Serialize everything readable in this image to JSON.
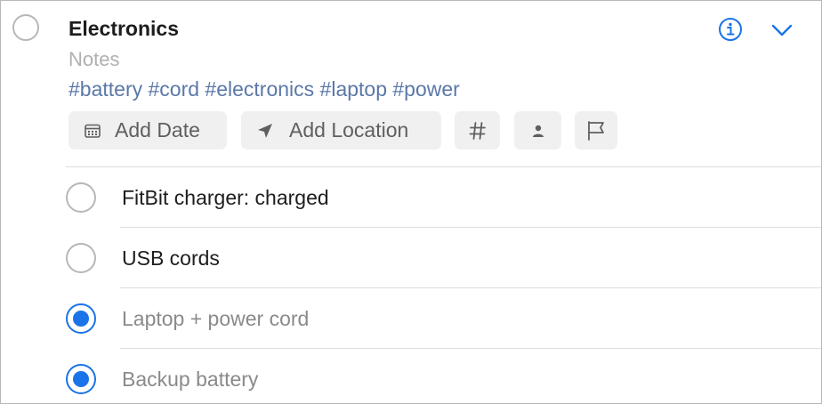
{
  "list": {
    "title": "Electronics",
    "notes_placeholder": "Notes",
    "tags": "#battery #cord #electronics #laptop #power"
  },
  "actions": {
    "add_date_label": "Add Date",
    "add_location_label": "Add Location"
  },
  "icons": {
    "info": "info-icon",
    "expand": "chevron-down-icon",
    "date": "calendar-icon",
    "location": "location-arrow-icon",
    "tag": "hashtag-icon",
    "person": "person-icon",
    "flag": "flag-icon"
  },
  "colors": {
    "accent": "#1a73e8",
    "tag_text": "#5a78a8"
  },
  "items": [
    {
      "label": "FitBit charger: charged",
      "completed": false
    },
    {
      "label": "USB cords",
      "completed": false
    },
    {
      "label": "Laptop + power cord",
      "completed": true
    },
    {
      "label": "Backup battery",
      "completed": true
    }
  ]
}
